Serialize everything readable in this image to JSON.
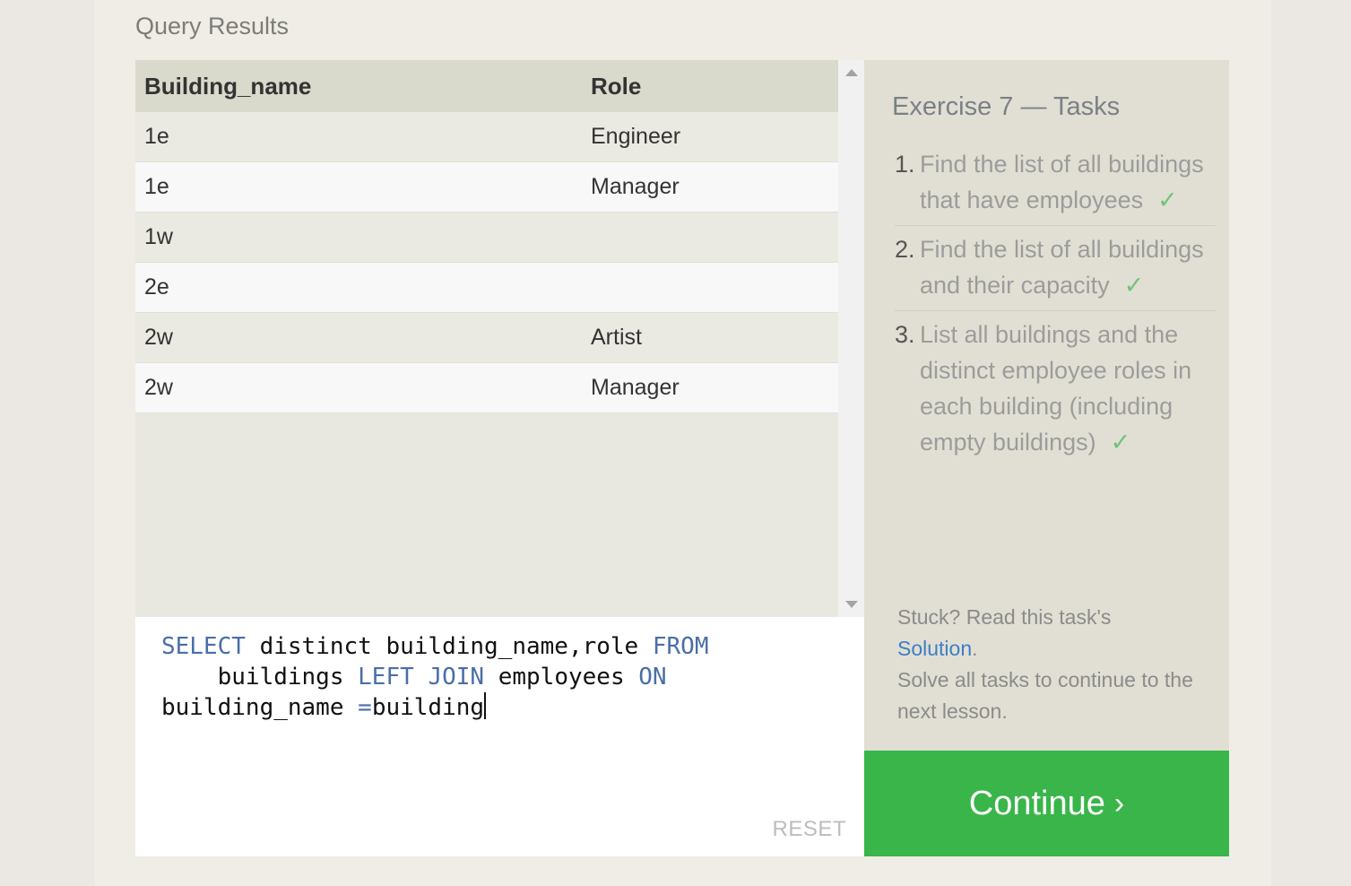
{
  "results": {
    "title": "Query Results",
    "columns": [
      "Building_name",
      "Role"
    ],
    "rows": [
      [
        "1e",
        "Engineer"
      ],
      [
        "1e",
        "Manager"
      ],
      [
        "1w",
        ""
      ],
      [
        "2e",
        ""
      ],
      [
        "2w",
        "Artist"
      ],
      [
        "2w",
        "Manager"
      ]
    ]
  },
  "editor": {
    "line1_kw1": "SELECT",
    "line1_text": " distinct building_name,role ",
    "line1_kw2": "FROM",
    "line2_indent": "    buildings ",
    "line2_kw1": "LEFT",
    "line2_sp": " ",
    "line2_kw2": "JOIN",
    "line2_text": " employees ",
    "line2_kw3": "ON",
    "line3_text1": "building_name ",
    "line3_op": "=",
    "line3_text2": "building",
    "reset_label": "RESET"
  },
  "tasks": {
    "title": "Exercise 7 — Tasks",
    "items": [
      {
        "num": "1.",
        "text": "Find the list of all buildings that have employees",
        "check": "✓"
      },
      {
        "num": "2.",
        "text": "Find the list of all buildings and their capacity",
        "check": "✓"
      },
      {
        "num": "3.",
        "text": "List all buildings and the distinct employee roles in each building (including empty buildings)",
        "check": "✓"
      }
    ],
    "help_prefix": "Stuck? Read this task's",
    "help_link": "Solution",
    "help_period": ".",
    "help_suffix": "Solve all tasks to continue to the next lesson."
  },
  "continue": {
    "label": "Continue",
    "chevron": "›"
  },
  "colors": {
    "accent_green": "#3ab54a",
    "keyword_blue": "#4a6ea8",
    "link_blue": "#3c7ec8",
    "check_green": "#6fc27a"
  }
}
